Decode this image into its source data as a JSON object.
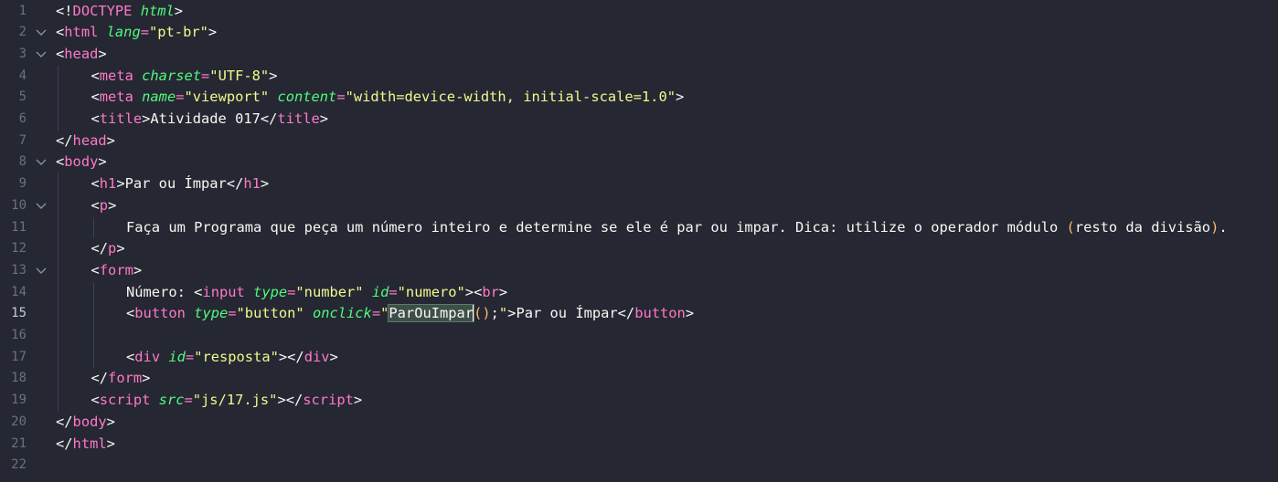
{
  "editor": {
    "lines": [
      {
        "n": "1",
        "fold": false,
        "indent": 0,
        "tokens": [
          [
            "p",
            "<!"
          ],
          [
            "t",
            "DOCTYPE"
          ],
          [
            "p",
            " "
          ],
          [
            "a",
            "html"
          ],
          [
            "p",
            ">"
          ]
        ]
      },
      {
        "n": "2",
        "fold": true,
        "indent": 0,
        "tokens": [
          [
            "p",
            "<"
          ],
          [
            "t",
            "html"
          ],
          [
            "p",
            " "
          ],
          [
            "a",
            "lang"
          ],
          [
            "t",
            "="
          ],
          [
            "s",
            "\"pt-br\""
          ],
          [
            "p",
            ">"
          ]
        ]
      },
      {
        "n": "3",
        "fold": true,
        "indent": 0,
        "tokens": [
          [
            "p",
            "<"
          ],
          [
            "t",
            "head"
          ],
          [
            "p",
            ">"
          ]
        ]
      },
      {
        "n": "4",
        "fold": false,
        "indent": 1,
        "tokens": [
          [
            "p",
            "<"
          ],
          [
            "t",
            "meta"
          ],
          [
            "p",
            " "
          ],
          [
            "a",
            "charset"
          ],
          [
            "t",
            "="
          ],
          [
            "s",
            "\"UTF-8\""
          ],
          [
            "p",
            ">"
          ]
        ]
      },
      {
        "n": "5",
        "fold": false,
        "indent": 1,
        "tokens": [
          [
            "p",
            "<"
          ],
          [
            "t",
            "meta"
          ],
          [
            "p",
            " "
          ],
          [
            "a",
            "name"
          ],
          [
            "t",
            "="
          ],
          [
            "s",
            "\"viewport\""
          ],
          [
            "p",
            " "
          ],
          [
            "a",
            "content"
          ],
          [
            "t",
            "="
          ],
          [
            "s",
            "\"width=device-width, initial-scale=1.0\""
          ],
          [
            "p",
            ">"
          ]
        ]
      },
      {
        "n": "6",
        "fold": false,
        "indent": 1,
        "tokens": [
          [
            "p",
            "<"
          ],
          [
            "t",
            "title"
          ],
          [
            "p",
            ">"
          ],
          [
            "x",
            "Atividade 017"
          ],
          [
            "p",
            "</"
          ],
          [
            "t",
            "title"
          ],
          [
            "p",
            ">"
          ]
        ]
      },
      {
        "n": "7",
        "fold": false,
        "indent": 0,
        "tokens": [
          [
            "p",
            "</"
          ],
          [
            "t",
            "head"
          ],
          [
            "p",
            ">"
          ]
        ]
      },
      {
        "n": "8",
        "fold": true,
        "indent": 0,
        "tokens": [
          [
            "p",
            "<"
          ],
          [
            "t",
            "body"
          ],
          [
            "p",
            ">"
          ]
        ]
      },
      {
        "n": "9",
        "fold": false,
        "indent": 1,
        "tokens": [
          [
            "p",
            "<"
          ],
          [
            "t",
            "h1"
          ],
          [
            "p",
            ">"
          ],
          [
            "x",
            "Par ou Ímpar"
          ],
          [
            "p",
            "</"
          ],
          [
            "t",
            "h1"
          ],
          [
            "p",
            ">"
          ]
        ]
      },
      {
        "n": "10",
        "fold": true,
        "indent": 1,
        "tokens": [
          [
            "p",
            "<"
          ],
          [
            "t",
            "p"
          ],
          [
            "p",
            ">"
          ]
        ]
      },
      {
        "n": "11",
        "fold": false,
        "indent": 2,
        "tokens": [
          [
            "x",
            "Faça um Programa que peça um número inteiro e determine se ele é par ou impar. Dica: utilize o operador módulo "
          ],
          [
            "b",
            "("
          ],
          [
            "x",
            "resto da divisão"
          ],
          [
            "b",
            ")"
          ],
          [
            "x",
            "."
          ]
        ]
      },
      {
        "n": "12",
        "fold": false,
        "indent": 1,
        "tokens": [
          [
            "p",
            "</"
          ],
          [
            "t",
            "p"
          ],
          [
            "p",
            ">"
          ]
        ]
      },
      {
        "n": "13",
        "fold": true,
        "indent": 1,
        "tokens": [
          [
            "p",
            "<"
          ],
          [
            "t",
            "form"
          ],
          [
            "p",
            ">"
          ]
        ]
      },
      {
        "n": "14",
        "fold": false,
        "indent": 2,
        "tokens": [
          [
            "x",
            "Número: "
          ],
          [
            "p",
            "<"
          ],
          [
            "t",
            "input"
          ],
          [
            "p",
            " "
          ],
          [
            "a",
            "type"
          ],
          [
            "t",
            "="
          ],
          [
            "s",
            "\"number\""
          ],
          [
            "p",
            " "
          ],
          [
            "a",
            "id"
          ],
          [
            "t",
            "="
          ],
          [
            "s",
            "\"numero\""
          ],
          [
            "p",
            ">"
          ],
          [
            "p",
            "<"
          ],
          [
            "t",
            "br"
          ],
          [
            "p",
            ">"
          ]
        ]
      },
      {
        "n": "15",
        "fold": false,
        "indent": 2,
        "current": true,
        "tokens": [
          [
            "p",
            "<"
          ],
          [
            "t",
            "button"
          ],
          [
            "p",
            " "
          ],
          [
            "a",
            "type"
          ],
          [
            "t",
            "="
          ],
          [
            "s",
            "\"button\""
          ],
          [
            "p",
            " "
          ],
          [
            "a",
            "onclick"
          ],
          [
            "t",
            "="
          ],
          [
            "s",
            "\""
          ],
          [
            "hl",
            "ParOuImpar"
          ],
          [
            "cursor",
            ""
          ],
          [
            "b",
            "()"
          ],
          [
            "x",
            ";"
          ],
          [
            "s",
            "\""
          ],
          [
            "p",
            ">"
          ],
          [
            "x",
            "Par ou Ímpar"
          ],
          [
            "p",
            "</"
          ],
          [
            "t",
            "button"
          ],
          [
            "p",
            ">"
          ]
        ]
      },
      {
        "n": "16",
        "fold": false,
        "indent": 2,
        "tokens": []
      },
      {
        "n": "17",
        "fold": false,
        "indent": 2,
        "tokens": [
          [
            "p",
            "<"
          ],
          [
            "t",
            "div"
          ],
          [
            "p",
            " "
          ],
          [
            "a",
            "id"
          ],
          [
            "t",
            "="
          ],
          [
            "s",
            "\"resposta\""
          ],
          [
            "p",
            ">"
          ],
          [
            "p",
            "</"
          ],
          [
            "t",
            "div"
          ],
          [
            "p",
            ">"
          ]
        ]
      },
      {
        "n": "18",
        "fold": false,
        "indent": 1,
        "tokens": [
          [
            "p",
            "</"
          ],
          [
            "t",
            "form"
          ],
          [
            "p",
            ">"
          ]
        ]
      },
      {
        "n": "19",
        "fold": false,
        "indent": 1,
        "tokens": [
          [
            "p",
            "<"
          ],
          [
            "t",
            "script"
          ],
          [
            "p",
            " "
          ],
          [
            "a",
            "src"
          ],
          [
            "t",
            "="
          ],
          [
            "s",
            "\"js/17.js\""
          ],
          [
            "p",
            ">"
          ],
          [
            "p",
            "</"
          ],
          [
            "t",
            "script"
          ],
          [
            "p",
            ">"
          ]
        ]
      },
      {
        "n": "20",
        "fold": false,
        "indent": 0,
        "tokens": [
          [
            "p",
            "</"
          ],
          [
            "t",
            "body"
          ],
          [
            "p",
            ">"
          ]
        ]
      },
      {
        "n": "21",
        "fold": false,
        "indent": 0,
        "tokens": [
          [
            "p",
            "</"
          ],
          [
            "t",
            "html"
          ],
          [
            "p",
            ">"
          ]
        ]
      },
      {
        "n": "22",
        "fold": false,
        "indent": 0,
        "tokens": []
      }
    ]
  },
  "colors": {
    "background": "#252733",
    "tag": "#ff79c6",
    "attribute": "#50fa7b",
    "string": "#f1fa8c",
    "bracket": "#ffb86c",
    "text": "#f8f8f2",
    "line_number": "#6b6f87"
  },
  "icons": {
    "fold": "chevron-down-icon"
  }
}
